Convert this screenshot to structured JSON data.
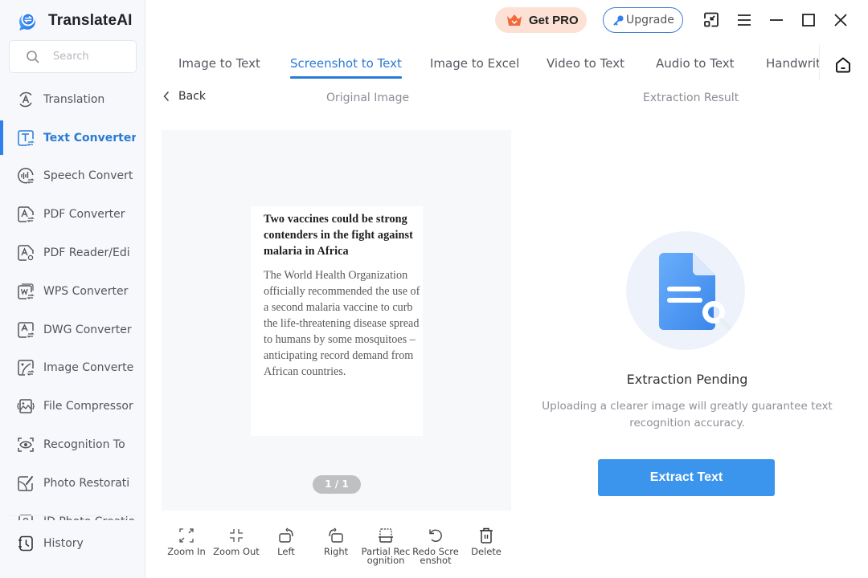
{
  "app": {
    "name": "TranslateAI",
    "accent_color": "#2a7bd4"
  },
  "sidebar": {
    "search_placeholder": "Search",
    "items": [
      {
        "label": "Translation",
        "icon": "translation-icon",
        "active": false
      },
      {
        "label": "Text Converter",
        "icon": "text-converter-icon",
        "active": true
      },
      {
        "label": "Speech Convert",
        "icon": "speech-convert-icon",
        "active": false
      },
      {
        "label": "PDF Converter",
        "icon": "pdf-converter-icon",
        "active": false
      },
      {
        "label": "PDF Reader/Edi",
        "icon": "pdf-reader-icon",
        "active": false
      },
      {
        "label": "WPS Converter",
        "icon": "wps-converter-icon",
        "active": false
      },
      {
        "label": "DWG Converter",
        "icon": "dwg-converter-icon",
        "active": false
      },
      {
        "label": "Image Converte",
        "icon": "image-converter-icon",
        "active": false
      },
      {
        "label": "File Compressor",
        "icon": "file-compressor-icon",
        "active": false
      },
      {
        "label": "Recognition To",
        "icon": "recognition-icon",
        "active": false
      },
      {
        "label": "Photo Restorati",
        "icon": "photo-restoration-icon",
        "active": false
      },
      {
        "label": "ID Photo Creatio",
        "icon": "id-photo-icon",
        "active": false
      }
    ],
    "history_label": "History"
  },
  "topbar": {
    "get_pro_label": "Get PRO",
    "upgrade_label": "Upgrade"
  },
  "tabs": [
    {
      "label": "Image to Text",
      "active": false
    },
    {
      "label": "Screenshot to Text",
      "active": true
    },
    {
      "label": "Image to Excel",
      "active": false
    },
    {
      "label": "Video to Text",
      "active": false
    },
    {
      "label": "Audio to Text",
      "active": false
    },
    {
      "label": "Handwrit",
      "active": false
    }
  ],
  "subheader": {
    "back_label": "Back",
    "original_title": "Original Image",
    "result_title": "Extraction Result"
  },
  "original_image": {
    "headline": "Two vaccines could be strong contenders in the fight against malaria in Africa",
    "body": "The World Health Organization officially recommended the use of a second malaria vaccine to curb the life-threatening disease spread to humans by some mosquitoes – anticipating record demand from African countries.",
    "pager": "1 / 1"
  },
  "toolbar": [
    {
      "label": "Zoom In",
      "icon": "zoom-in-icon"
    },
    {
      "label": "Zoom Out",
      "icon": "zoom-out-icon"
    },
    {
      "label": "Left",
      "icon": "rotate-left-icon"
    },
    {
      "label": "Right",
      "icon": "rotate-right-icon"
    },
    {
      "label": "Partial Recognition",
      "icon": "partial-recognition-icon"
    },
    {
      "label": "Redo Screenshot",
      "icon": "redo-screenshot-icon"
    },
    {
      "label": "Delete",
      "icon": "delete-icon"
    }
  ],
  "result": {
    "status_title": "Extraction Pending",
    "status_desc": "Uploading a clearer image will greatly guarantee text recognition accuracy.",
    "extract_button": "Extract Text",
    "button_color": "#3b95ec"
  }
}
